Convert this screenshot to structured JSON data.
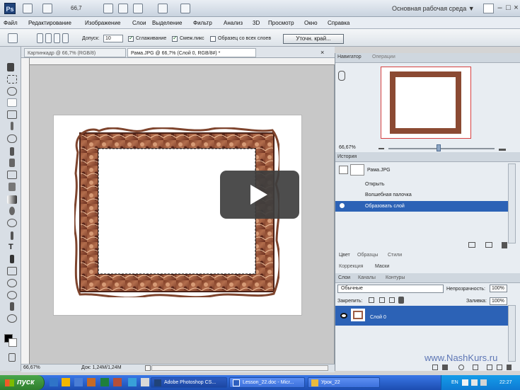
{
  "titlebar": {
    "app_logo": "Ps",
    "zoom": "66,7",
    "workspace": "Основная рабочая среда",
    "workspace_arrow": "▼",
    "search_icon": "search-icon",
    "minimize": "–",
    "maximize": "□",
    "close": "×"
  },
  "menu": [
    "Файл",
    "Редактирование",
    "Изображение",
    "Слои",
    "Выделение",
    "Фильтр",
    "Анализ",
    "3D",
    "Просмотр",
    "Окно",
    "Справка"
  ],
  "options": {
    "tolerance_label": "Допуск:",
    "tolerance_value": "10",
    "anti_alias_label": "Сглаживание",
    "contiguous_label": "Смеж.пикс",
    "sample_all_label": "Образец со всех слоев",
    "refine_edge": "Уточн. край..."
  },
  "document_tabs": [
    "Картинкадр @ 66,7% (RGB/8)",
    "Рама.JPG @ 66,7% (Слой 0, RGB/8#) *"
  ],
  "status": {
    "zoom": "66,67%",
    "doc": "Док: 1,24M/1,24M"
  },
  "navigator": {
    "tabs": [
      "Навигатор",
      "Операции"
    ],
    "zoom": "66,67%"
  },
  "history": {
    "title": "История",
    "snapshot_label": "Рама.JPG",
    "items": [
      "Открыть",
      "Волшебная палочка",
      "Образовать слой"
    ],
    "active_index": 2
  },
  "panel_tabs": {
    "row1": [
      "Цвет",
      "Образцы",
      "Стили"
    ],
    "row2": [
      "Коррекция",
      "Маски"
    ],
    "row3": [
      "Слои",
      "Каналы",
      "Контуры"
    ]
  },
  "layers": {
    "blend": "Обычные",
    "opacity_label": "Непрозрачность:",
    "opacity": "100%",
    "lock_label": "Закрепить:",
    "fill_label": "Заливка:",
    "fill": "100%",
    "layer_name": "Слой 0"
  },
  "watermark": "www.NashKurs.ru",
  "taskbar": {
    "start": "пуск",
    "buttons": [
      "Adobe Photoshop CS...",
      "Lesson_22.doc - Micr...",
      "Урок_22"
    ],
    "language": "EN",
    "time": "22:27"
  }
}
